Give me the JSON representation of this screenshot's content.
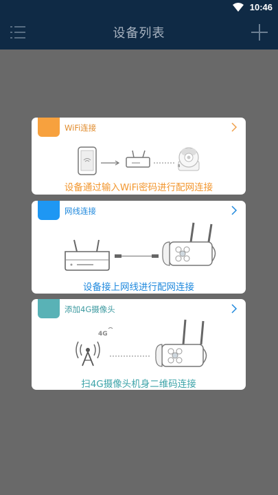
{
  "status": {
    "time": "10:46"
  },
  "header": {
    "title": "设备列表"
  },
  "cards": [
    {
      "label": "WiFi连接",
      "desc": "设备通过输入WiFi密码进行配网连接",
      "color": "#f7a13e"
    },
    {
      "label": "网线连接",
      "desc": "设备接上网线进行配网连接",
      "color": "#1e97f3"
    },
    {
      "label": "添加4G摄像头",
      "desc": "扫4G摄像头机身二维码连接",
      "color": "#59b2b6"
    }
  ],
  "icons": {
    "menu": "list-menu-icon",
    "add": "plus-icon",
    "wifi": "wifi-signal-icon"
  },
  "illustration_text": {
    "4g": "4G"
  }
}
